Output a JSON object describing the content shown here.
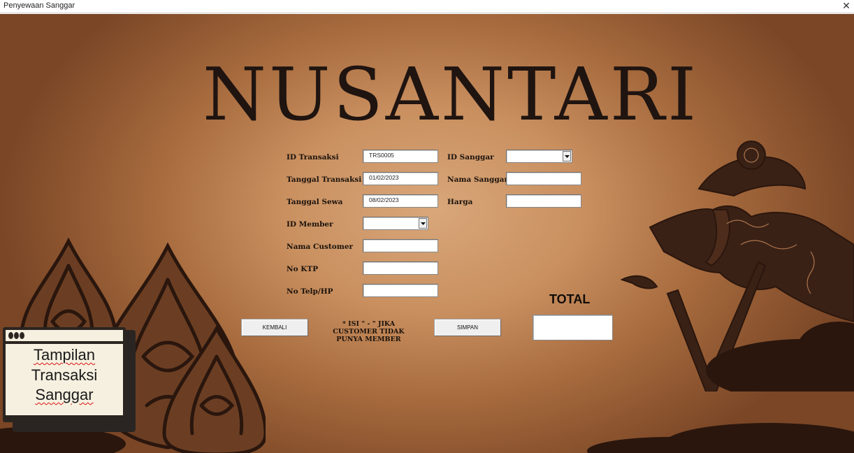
{
  "window": {
    "title": "Penyewaan Sanggar",
    "close_glyph": "✕"
  },
  "logo": {
    "text": "NUSANTARI"
  },
  "form": {
    "id_transaksi": {
      "label": "ID Transaksi",
      "value": "TRS0005"
    },
    "tanggal_transaksi": {
      "label": "Tanggal Transaksi",
      "value": "01/02/2023"
    },
    "tanggal_sewa": {
      "label": "Tanggal Sewa",
      "value": "08/02/2023"
    },
    "id_member": {
      "label": "ID Member",
      "value": ""
    },
    "nama_customer": {
      "label": "Nama Customer",
      "value": ""
    },
    "no_ktp": {
      "label": "No KTP",
      "value": ""
    },
    "no_telp": {
      "label": "No Telp/HP",
      "value": ""
    },
    "id_sanggar": {
      "label": "ID Sanggar",
      "value": ""
    },
    "nama_sanggar": {
      "label": "Nama Sanggar",
      "value": ""
    },
    "harga": {
      "label": "Harga",
      "value": ""
    }
  },
  "buttons": {
    "kembali": "KEMBALI",
    "simpan": "SIMPAN"
  },
  "note": "* ISI \" - \" JIKA CUSTOMER TIDAK PUNYA MEMBER",
  "total": {
    "label": "TOTAL",
    "value": ""
  },
  "card": {
    "line1": "Tampilan",
    "line2": "Transaksi",
    "line3": "Sanggar"
  },
  "colors": {
    "background": "#c98f5f",
    "text_dark": "#1a120c",
    "silhouette": "#3a2116"
  },
  "icons": [
    "close-icon",
    "dropdown-arrow-icon",
    "wayang-silhouette",
    "gunungan-ornament"
  ]
}
